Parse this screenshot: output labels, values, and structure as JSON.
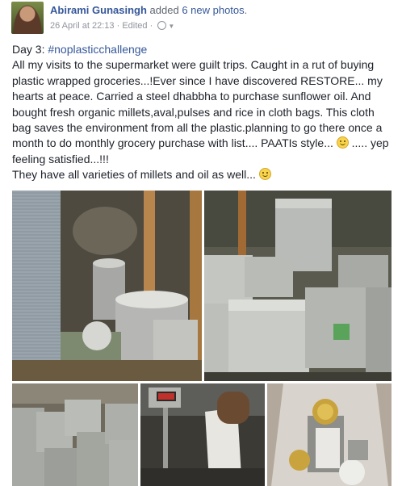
{
  "post": {
    "author": "Abirami Gunasingh",
    "action_prefix": "added",
    "action_count": "6 new photos",
    "action_suffix": ".",
    "timestamp": "26 April at 22:13",
    "separator": "·",
    "edited": "Edited",
    "separator2": "·"
  },
  "body": {
    "line1": "Day 3: ",
    "hashtag": "#noplasticchallenge",
    "paragraph": "All my visits to the supermarket were guilt trips. Caught in a rut of buying plastic wrapped groceries...!Ever since I have discovered RESTORE... my hearts at peace. Carried a steel dhabbha to purchase sunflower oil. And bought fresh organic millets,aval,pulses and rice in cloth bags. This cloth bag saves the environment from all the plastic.planning to go there once a month to do monthly grocery purchase with list.... PAATIs style...",
    "paragraph_tail": "..... yep feeling satisfied...!!!",
    "last_line": "They have all varieties of millets and oil as well..."
  },
  "photos": [
    {
      "name": "steel-dabba-oil-photo"
    },
    {
      "name": "steel-bins-store-photo"
    },
    {
      "name": "storage-boxes-photo"
    },
    {
      "name": "weighing-scale-photo"
    },
    {
      "name": "cloth-bag-jars-photo"
    }
  ],
  "icons": {
    "audience": "globe-icon",
    "menu": "caret-down-icon",
    "emoji": "smiley-icon"
  },
  "colors": {
    "link": "#365899",
    "text": "#1d2129",
    "meta": "#90949c"
  }
}
